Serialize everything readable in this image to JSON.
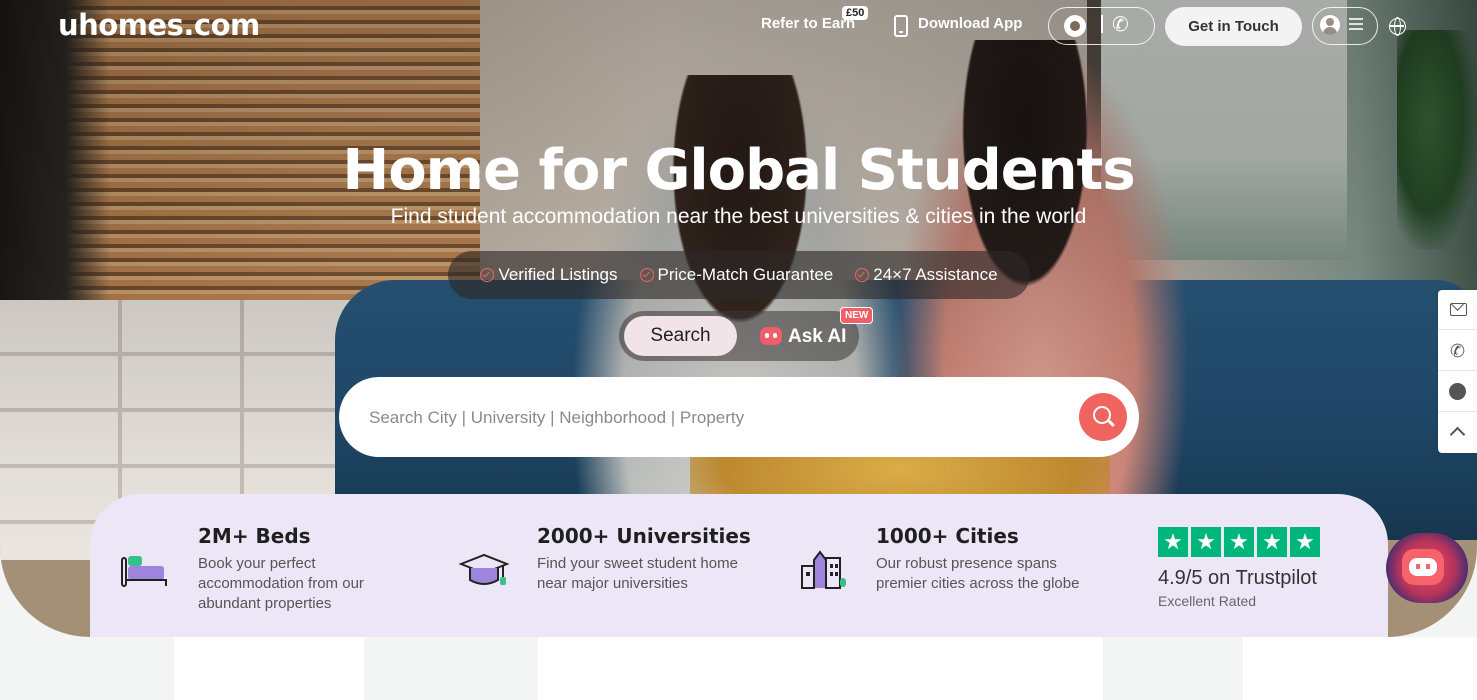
{
  "header": {
    "logo": "uhomes.com",
    "refer_label": "Refer to Earn",
    "refer_badge": "£50",
    "download_label": "Download App",
    "get_in_touch_label": "Get in Touch"
  },
  "hero": {
    "title": "Home for Global Students",
    "subtitle": "Find student accommodation near the best universities & cities in the world",
    "features": [
      "Verified Listings",
      "Price-Match Guarantee",
      "24×7 Assistance"
    ],
    "mode_search_label": "Search",
    "mode_ai_label": "Ask AI",
    "new_badge": "NEW",
    "search_placeholder": "Search City | University | Neighborhood | Property"
  },
  "stats": [
    {
      "title": "2M+ Beds",
      "desc": [
        "Book your perfect",
        "accommodation from our",
        "abundant properties"
      ]
    },
    {
      "title": "2000+ Universities",
      "desc": [
        "Find your sweet student home",
        "near major universities"
      ]
    },
    {
      "title": "1000+ Cities",
      "desc": [
        "Our robust presence spans",
        "premier cities across the globe"
      ]
    }
  ],
  "trustpilot": {
    "rating_text": "4.9/5 on Trustpilot",
    "sub_text": "Excellent Rated",
    "stars": 5
  },
  "colors": {
    "accent": "#f0645f",
    "stats_bg": "#ece6f7",
    "trustpilot_green": "#00b67a",
    "ai_pink": "#f05e69"
  },
  "icons": {
    "sidebar": [
      "mail-icon",
      "phone-icon",
      "whatsapp-icon",
      "chevron-up-icon"
    ]
  }
}
